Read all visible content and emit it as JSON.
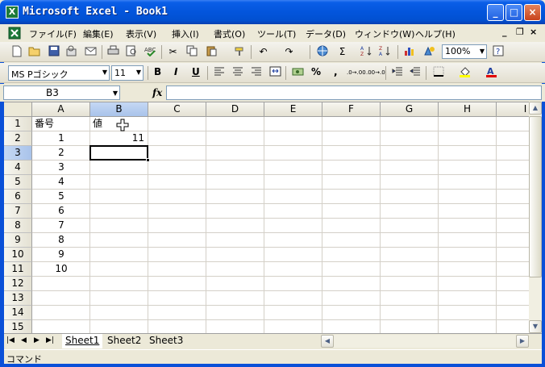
{
  "window": {
    "title": "Microsoft Excel - Book1",
    "app_icon_glyph": "X",
    "minimize_glyph": "_",
    "maximize_glyph": "□",
    "close_glyph": "×"
  },
  "menu": {
    "items": [
      "ファイル(F)",
      "編集(E)",
      "表示(V)",
      "挿入(I)",
      "書式(O)",
      "ツール(T)",
      "データ(D)",
      "ウィンドウ(W)",
      "ヘルプ(H)"
    ],
    "doc_minimize": "_",
    "doc_restore": "❐",
    "doc_close": "×"
  },
  "toolbar_standard": {
    "zoom": "100%",
    "autosum": "Σ",
    "icons": [
      "new-icon",
      "open-icon",
      "save-icon",
      "permission-icon",
      "mail-icon",
      "print-icon",
      "print-preview-icon",
      "spelling-icon",
      "cut-icon",
      "copy-icon",
      "paste-icon",
      "format-painter-icon",
      "undo-icon",
      "redo-icon",
      "hyperlink-icon",
      "autosum-icon",
      "sort-ascending-icon",
      "sort-descending-icon",
      "chart-wizard-icon",
      "drawing-icon",
      "help-icon"
    ]
  },
  "toolbar_formatting": {
    "font_name": "MS Pゴシック",
    "font_size": "11",
    "bold": "B",
    "italic": "I",
    "underline": "U",
    "percent": "%",
    "comma": ",",
    "increase_decimal": ".0→.00",
    "decrease_decimal": ".00→.0"
  },
  "formula_bar": {
    "name_box": "B3",
    "fx_label": "fx",
    "formula": ""
  },
  "sheet": {
    "columns": [
      "A",
      "B",
      "C",
      "D",
      "E",
      "F",
      "G",
      "H",
      "I"
    ],
    "selected_column": "B",
    "rows": [
      "1",
      "2",
      "3",
      "4",
      "5",
      "6",
      "7",
      "8",
      "9",
      "10",
      "11",
      "12",
      "13",
      "14",
      "15"
    ],
    "selected_row": "3",
    "cells": {
      "A1": "番号",
      "B1": "値",
      "B2": "11",
      "A2": "1",
      "A3": "2",
      "A4": "3",
      "A5": "4",
      "A6": "5",
      "A7": "6",
      "A8": "7",
      "A9": "8",
      "A10": "9",
      "A11": "10"
    },
    "active_cell": "B3"
  },
  "sheet_tabs": {
    "tabs": [
      "Sheet1",
      "Sheet2",
      "Sheet3"
    ],
    "active": "Sheet1",
    "nav": [
      "|◀",
      "◀",
      "▶",
      "▶|"
    ]
  },
  "statusbar": {
    "mode": "コマンド"
  }
}
